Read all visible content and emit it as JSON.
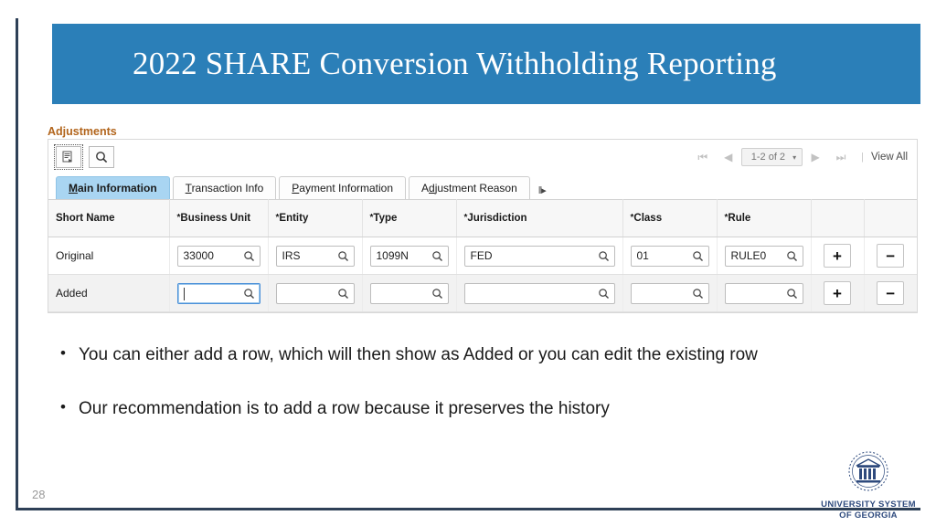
{
  "slide": {
    "title": "2022 SHARE Conversion Withholding Reporting",
    "number": "28",
    "banner_color": "#2b7fb8",
    "frame_color": "#2e4057"
  },
  "section": {
    "label": "Adjustments",
    "label_color": "#b2651c"
  },
  "toolbar": {
    "personalize_icon": "grid-personalize-icon",
    "find_icon": "search-icon"
  },
  "pager": {
    "first_label": "⏮",
    "prev_label": "◀",
    "range": "1-2 of 2",
    "caret": "▾",
    "next_label": "▶",
    "last_label": "⏭",
    "divider": "|",
    "view_all": "View All"
  },
  "tabs": [
    {
      "label": "Main Information",
      "accesskey": "M",
      "active": true
    },
    {
      "label": "Transaction Info",
      "accesskey": "T",
      "active": false
    },
    {
      "label": "Payment Information",
      "accesskey": "P",
      "active": false
    },
    {
      "label": "Adjustment Reason",
      "accesskey": "A",
      "active": false
    }
  ],
  "tabs_more": "‖▸",
  "grid": {
    "headers": [
      {
        "label": "Short Name",
        "required": false
      },
      {
        "label": "Business Unit",
        "required": true
      },
      {
        "label": "Entity",
        "required": true
      },
      {
        "label": "Type",
        "required": true
      },
      {
        "label": "Jurisdiction",
        "required": true
      },
      {
        "label": "Class",
        "required": true
      },
      {
        "label": "Rule",
        "required": true
      },
      {
        "label": "",
        "required": false
      },
      {
        "label": "",
        "required": false
      }
    ],
    "rows": [
      {
        "short_name": "Original",
        "business_unit": "33000",
        "entity": "IRS",
        "type": "1099N",
        "jurisdiction": "FED",
        "class": "01",
        "rule": "RULE0",
        "add_label": "+",
        "remove_label": "−",
        "focused": false
      },
      {
        "short_name": "Added",
        "business_unit": "",
        "entity": "",
        "type": "",
        "jurisdiction": "",
        "class": "",
        "rule": "",
        "add_label": "+",
        "remove_label": "−",
        "focused": true
      }
    ]
  },
  "bullets": [
    "You can either add a row, which will then show as Added or you can edit the existing row",
    "Our recommendation is to add a row because it preserves the history"
  ],
  "bullet_marker": "•",
  "logo": {
    "line1": "UNIVERSITY SYSTEM",
    "line2": "OF GEORGIA",
    "color": "#2e4a7d"
  }
}
